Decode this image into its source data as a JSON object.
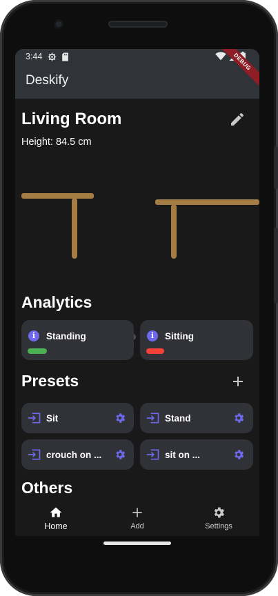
{
  "status_bar": {
    "time": "3:44"
  },
  "app_bar": {
    "title": "Deskify",
    "debug_banner": "DEBUG"
  },
  "room": {
    "name": "Living Room",
    "height_text": "Height: 84.5 cm"
  },
  "carousel": {
    "page_count": 2,
    "active_index": 1
  },
  "sections": {
    "analytics": "Analytics",
    "presets": "Presets",
    "others": "Others"
  },
  "analytics": [
    {
      "label": "Standing",
      "color": "#4caf50"
    },
    {
      "label": "Sitting",
      "color": "#f44336"
    }
  ],
  "presets": [
    {
      "label": "Sit"
    },
    {
      "label": "Stand"
    },
    {
      "label": "crouch on ..."
    },
    {
      "label": "sit on ..."
    }
  ],
  "nav": {
    "home": "Home",
    "add": "Add",
    "settings": "Settings"
  },
  "colors": {
    "accent": "#6e69ec",
    "desk": "#a57c43",
    "card_bg": "#303238",
    "appbar_bg": "#303439",
    "screen_bg": "#191919"
  },
  "icons": {
    "edit": "pencil-icon",
    "info": "info-icon",
    "add": "plus-icon",
    "preset": "input-icon",
    "preset_settings": "gear-icon",
    "home": "home-icon",
    "settings": "settings-gear-icon"
  }
}
